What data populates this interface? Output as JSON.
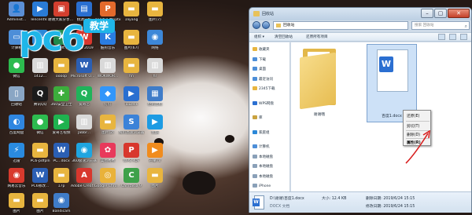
{
  "desktop": {
    "icons": [
      {
        "label": "Administ...",
        "color": "#5b8fd6",
        "glyph": "👤"
      },
      {
        "label": "TencentV...",
        "color": "#2a7bd6",
        "glyph": "▶"
      },
      {
        "label": "谢谢大家分享了...exe",
        "color": "#d33f2f",
        "glyph": "▣"
      },
      {
        "label": "桃源日报",
        "color": "#2a6fd0",
        "glyph": "▤"
      },
      {
        "label": "小川家长会pptx",
        "color": "#e36a2c",
        "glyph": "P"
      },
      {
        "label": "1liyang",
        "color": "#e8b53f",
        "glyph": "▬"
      },
      {
        "label": "图片(7)",
        "color": "#e8b53f",
        "glyph": "▬"
      },
      {
        "label": "计算机",
        "color": "#4d8ed8",
        "glyph": "▭"
      },
      {
        "label": "tv",
        "color": "#2b88d8",
        "glyph": "▶"
      },
      {
        "label": "Microsoft Office Exc...",
        "color": "#1f8a4c",
        "glyph": "X"
      },
      {
        "label": "WPS 2019",
        "color": "#d8372d",
        "glyph": "W"
      },
      {
        "label": "酷狗音乐",
        "color": "#2a7de1",
        "glyph": "K"
      },
      {
        "label": "图片(67)",
        "color": "#e8b53f",
        "glyph": "▬"
      },
      {
        "label": "网络",
        "color": "#3d88d8",
        "glyph": "◉"
      },
      {
        "label": "微信",
        "color": "#2dbb4f",
        "glyph": "●"
      },
      {
        "label": "1412...",
        "color": "#d9d9d9",
        "glyph": "▥"
      },
      {
        "label": "oooop",
        "color": "#e8b53f",
        "glyph": "▬"
      },
      {
        "label": "Microsoft Office Wor...",
        "color": "#2b5fb4",
        "glyph": "W"
      },
      {
        "label": "WOKWOR...",
        "color": "#d9d9d9",
        "glyph": "▥"
      },
      {
        "label": "hn",
        "color": "#e8b53f",
        "glyph": "▬"
      },
      {
        "label": "hr",
        "color": "#d9d9d9",
        "glyph": "▥"
      },
      {
        "label": "回收站",
        "color": "#8aa6c4",
        "glyph": "▯"
      },
      {
        "label": "腾讯QQ",
        "color": "#1b1b1b",
        "glyph": "Q"
      },
      {
        "label": "360安全卫士",
        "color": "#3cae3c",
        "glyph": "✚"
      },
      {
        "label": "爱奇艺",
        "color": "#20b35a",
        "glyph": "Q"
      },
      {
        "label": "钉钉",
        "color": "#3296fa",
        "glyph": "◆"
      },
      {
        "label": "ToDesk",
        "color": "#2a6fd0",
        "glyph": "▶"
      },
      {
        "label": "控制面板",
        "color": "#3f7cc8",
        "glyph": "▦"
      },
      {
        "label": "百度网盘",
        "color": "#2f86e0",
        "glyph": "◐"
      },
      {
        "label": "微信",
        "color": "#2dbb4f",
        "glyph": "●"
      },
      {
        "label": "爱奇艺视频",
        "color": "#1fb24f",
        "glyph": "▶"
      },
      {
        "label": "Jabbr...",
        "color": "#d9d9d9",
        "glyph": "▥"
      },
      {
        "label": "图片(2)",
        "color": "#e8b53f",
        "glyph": "▬"
      },
      {
        "label": "搜狗高速浏览器",
        "color": "#3b82d8",
        "glyph": "S"
      },
      {
        "label": "优酷",
        "color": "#1d9be3",
        "glyph": "▶"
      },
      {
        "label": "迅雷",
        "color": "#2a8be0",
        "glyph": "⚡"
      },
      {
        "label": "PC6-pdfpln",
        "color": "#e8b53f",
        "glyph": "▬"
      },
      {
        "label": "PC...docx",
        "color": "#2b5fb4",
        "glyph": "W"
      },
      {
        "label": "360极速浏览器",
        "color": "#1fa5e0",
        "glyph": "◉"
      },
      {
        "label": "美图秀秀",
        "color": "#e8395b",
        "glyph": "✿"
      },
      {
        "label": "WPS PDF",
        "color": "#d8372d",
        "glyph": "P"
      },
      {
        "label": "芒果TV",
        "color": "#f08c1e",
        "glyph": "▶"
      },
      {
        "label": "网易云音乐",
        "color": "#d83a2d",
        "glyph": "◉"
      },
      {
        "label": "PC6修改...",
        "color": "#2b5fb4",
        "glyph": "W"
      },
      {
        "label": "17p",
        "color": "#e8b53f",
        "glyph": "▬"
      },
      {
        "label": "Adobe Creati...",
        "color": "#d8372d",
        "glyph": "A"
      },
      {
        "label": "Google Chrome",
        "color": "#e9b23a",
        "glyph": "◎"
      },
      {
        "label": "Camtasia 9",
        "color": "#3fa14a",
        "glyph": "C"
      },
      {
        "label": "图片",
        "color": "#e8b53f",
        "glyph": "▬"
      },
      {
        "label": "图片",
        "color": "#e8b53f",
        "glyph": "▬"
      },
      {
        "label": "图片",
        "color": "#e8b53f",
        "glyph": "▬"
      },
      {
        "label": "Bandicam",
        "color": "#3f7cc8",
        "glyph": "◉"
      }
    ],
    "logo": {
      "main": "pc6",
      "badge": "教学"
    }
  },
  "explorer": {
    "title": "回收站",
    "address": "回收站",
    "search_placeholder": "搜索 回收站",
    "toolbar": [
      "组织 ▾",
      "清空回收站",
      "还原所有项目"
    ],
    "nav_items": [
      {
        "label": "收藏夹",
        "color": "#e8b53f"
      },
      {
        "label": "下载",
        "color": "#4d8ed8"
      },
      {
        "label": "桌面",
        "color": "#4d8ed8"
      },
      {
        "label": "最近访问",
        "color": "#4d8ed8"
      },
      {
        "label": "2345下载",
        "color": "#e8b53f"
      },
      {
        "label": "WPS网盘",
        "color": "#2b6fd1"
      },
      {
        "label": "库",
        "color": "#c9a23f"
      },
      {
        "label": "家庭组",
        "color": "#2b88d8"
      },
      {
        "label": "计算机",
        "color": "#4d8ed8"
      },
      {
        "label": "本地磁盘",
        "color": "#8aa0b8"
      },
      {
        "label": "本地磁盘",
        "color": "#8aa0b8"
      },
      {
        "label": "本地磁盘",
        "color": "#8aa0b8"
      },
      {
        "label": "iPhone",
        "color": "#8aa0b8"
      }
    ],
    "folder_name": "谢谢哦",
    "file_name": "百度1.docx",
    "context_menu": [
      "还原(E)",
      "剪切(T)",
      "删除(D)",
      "属性(R)"
    ],
    "details": {
      "path": "D:\\谢谢\\百度1.docx",
      "type": "DOCX 文档",
      "size_label": "大小: 12.4 KB",
      "deleted_label": "删除日期: 2019/6/24 15:15",
      "modified_label": "修改日期: 2019/6/24 15:15"
    }
  }
}
